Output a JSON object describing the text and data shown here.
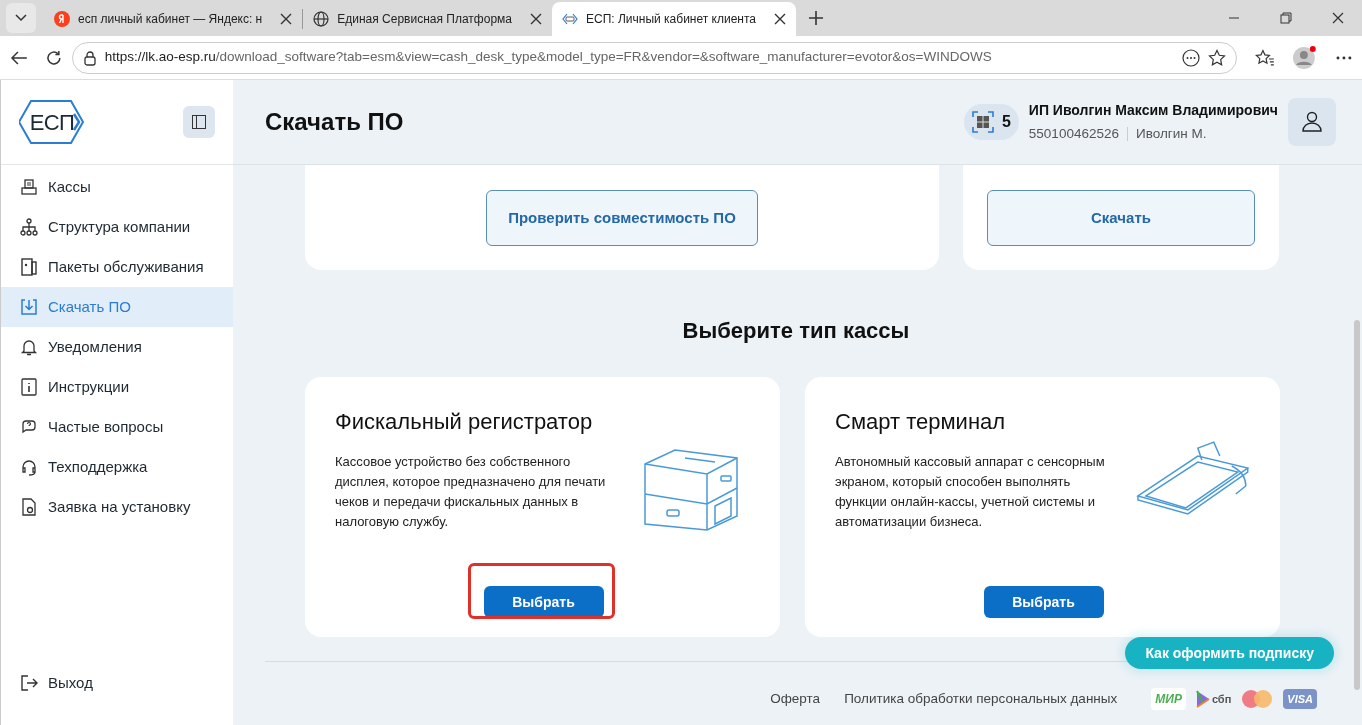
{
  "browser": {
    "tabs": [
      {
        "title": "есп личный кабинет — Яндекс: н",
        "selected": false
      },
      {
        "title": "Единая Сервисная Платформа",
        "selected": false
      },
      {
        "title": "ЕСП: Личный кабинет клиента",
        "selected": true
      }
    ],
    "url_host": "https://lk.ao-esp.ru",
    "url_path": "/download_software?tab=esm&view=cash_desk_type&model_type=FR&vendor=&software_manufacturer=evotor&os=WINDOWS"
  },
  "logo": "ЕСП",
  "sidebar": {
    "items": [
      {
        "label": "Кассы",
        "selected": false
      },
      {
        "label": "Структура компании",
        "selected": false
      },
      {
        "label": "Пакеты обслуживания",
        "selected": false
      },
      {
        "label": "Скачать ПО",
        "selected": true
      },
      {
        "label": "Уведомления",
        "selected": false
      },
      {
        "label": "Инструкции",
        "selected": false
      },
      {
        "label": "Частые вопросы",
        "selected": false
      },
      {
        "label": "Техподдержка",
        "selected": false
      },
      {
        "label": "Заявка на установку",
        "selected": false
      }
    ],
    "logout": "Выход"
  },
  "header": {
    "title": "Скачать ПО",
    "badge_count": "5",
    "company": "ИП Иволгин Максим Владимирович",
    "inn": "550100462526",
    "user": "Иволгин М."
  },
  "top_cards": [
    {
      "button": "Проверить совместимость ПО"
    },
    {
      "button": "Скачать"
    }
  ],
  "section_title": "Выберите тип кассы",
  "cash_types": [
    {
      "kind": "printer",
      "title": "Фискальный регистратор",
      "description": "Кассовое устройство без собственного дисплея, которое предназначено для печати чеков и передачи фискальных данных в налоговую службу.",
      "button": "Выбрать",
      "highlighted": true
    },
    {
      "kind": "terminal",
      "title": "Смарт терминал",
      "description": "Автономный кассовый аппарат с сенсорным экраном, который способен выполнять функции онлайн-кассы, учетной системы и автоматизации бизнеса.",
      "button": "Выбрать",
      "highlighted": false
    }
  ],
  "subscribe_button": "Как оформить подписку",
  "footer": {
    "links": [
      "Оферта",
      "Политика обработки персональных данных"
    ],
    "payment_logos": [
      "МИР",
      "сбп",
      "VISA"
    ]
  }
}
